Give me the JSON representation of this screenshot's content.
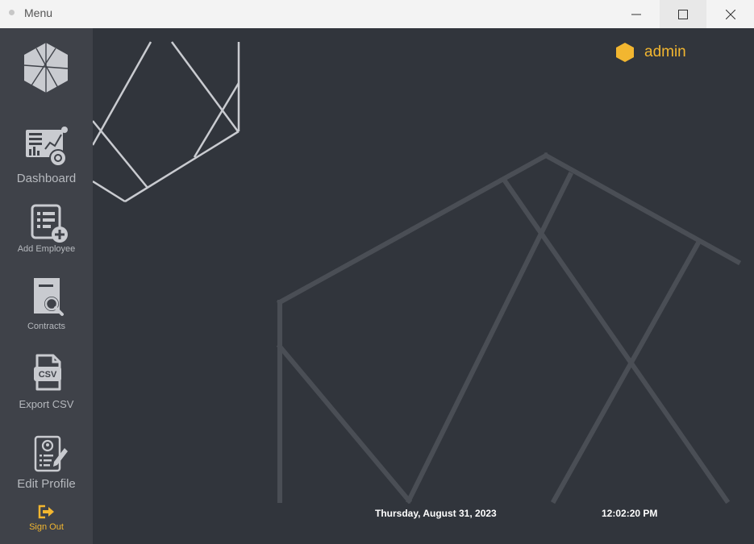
{
  "window": {
    "title": "Menu",
    "controls": [
      "minimize-icon",
      "maximize-icon",
      "close-icon"
    ]
  },
  "sidebar": {
    "items": [
      {
        "label": "Dashboard",
        "icon": "dashboard-icon"
      },
      {
        "label": "Add Employee",
        "icon": "add-employee-icon"
      },
      {
        "label": "Contracts",
        "icon": "contracts-search-icon"
      },
      {
        "label": "Export CSV",
        "icon": "csv-file-icon"
      },
      {
        "label": "Edit Profile",
        "icon": "edit-profile-icon"
      },
      {
        "label": "Sign Out",
        "icon": "sign-out-icon"
      }
    ],
    "csv_icon_text": "CSV"
  },
  "header": {
    "username": "admin",
    "user_icon": "hexagon-icon"
  },
  "statusbar": {
    "date": "Thursday, August 31, 2023",
    "time": "12:02:20 PM"
  },
  "colors": {
    "accent": "#f2b630",
    "sidebar_bg": "#3f4249",
    "main_bg": "#31353c",
    "sidebar_text": "#b6b9be"
  }
}
